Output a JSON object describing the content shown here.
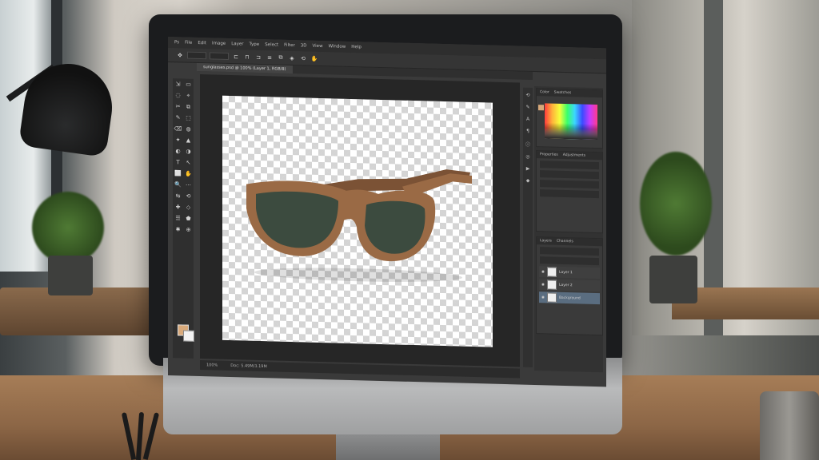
{
  "menu": {
    "items": [
      "Ps",
      "File",
      "Edit",
      "Image",
      "Layer",
      "Type",
      "Select",
      "Filter",
      "3D",
      "View",
      "Window",
      "Help"
    ]
  },
  "options_bar": {
    "icons": [
      "move-icon",
      "tool-preset-icon",
      "align-icon",
      "distribute-icon",
      "arrange-icon",
      "3d-mode-icon"
    ]
  },
  "document": {
    "tab_label": "sunglasses.psd @ 100% (Layer 1, RGB/8)"
  },
  "status": {
    "zoom": "100%",
    "info": "Doc: 5.49M/3.19M"
  },
  "toolbar": {
    "tools": [
      "⇲",
      "▭",
      "◌",
      "⌖",
      "✂",
      "⧉",
      "✎",
      "⬚",
      "⌫",
      "◍",
      "✦",
      "▲",
      "◐",
      "◑",
      "T",
      "↖",
      "⬜",
      "✋",
      "🔍",
      "⋯",
      "⇆",
      "⟲",
      "✚",
      "◇",
      "☰",
      "⬟",
      "✱",
      "⊕"
    ]
  },
  "panels": {
    "color_tabs": [
      "Color",
      "Swatches"
    ],
    "properties_tabs": [
      "Properties",
      "Adjustments"
    ],
    "layers_tabs": [
      "Layers",
      "Channels"
    ],
    "layers": [
      {
        "name": "Layer 1",
        "active": false
      },
      {
        "name": "Layer 2",
        "active": false
      },
      {
        "name": "Background",
        "active": true
      }
    ]
  },
  "colors": {
    "foreground": "#d8a97a",
    "background": "#f2f2f2",
    "lens": "#3c4b3f",
    "frame_wood": "#9a6a45"
  }
}
